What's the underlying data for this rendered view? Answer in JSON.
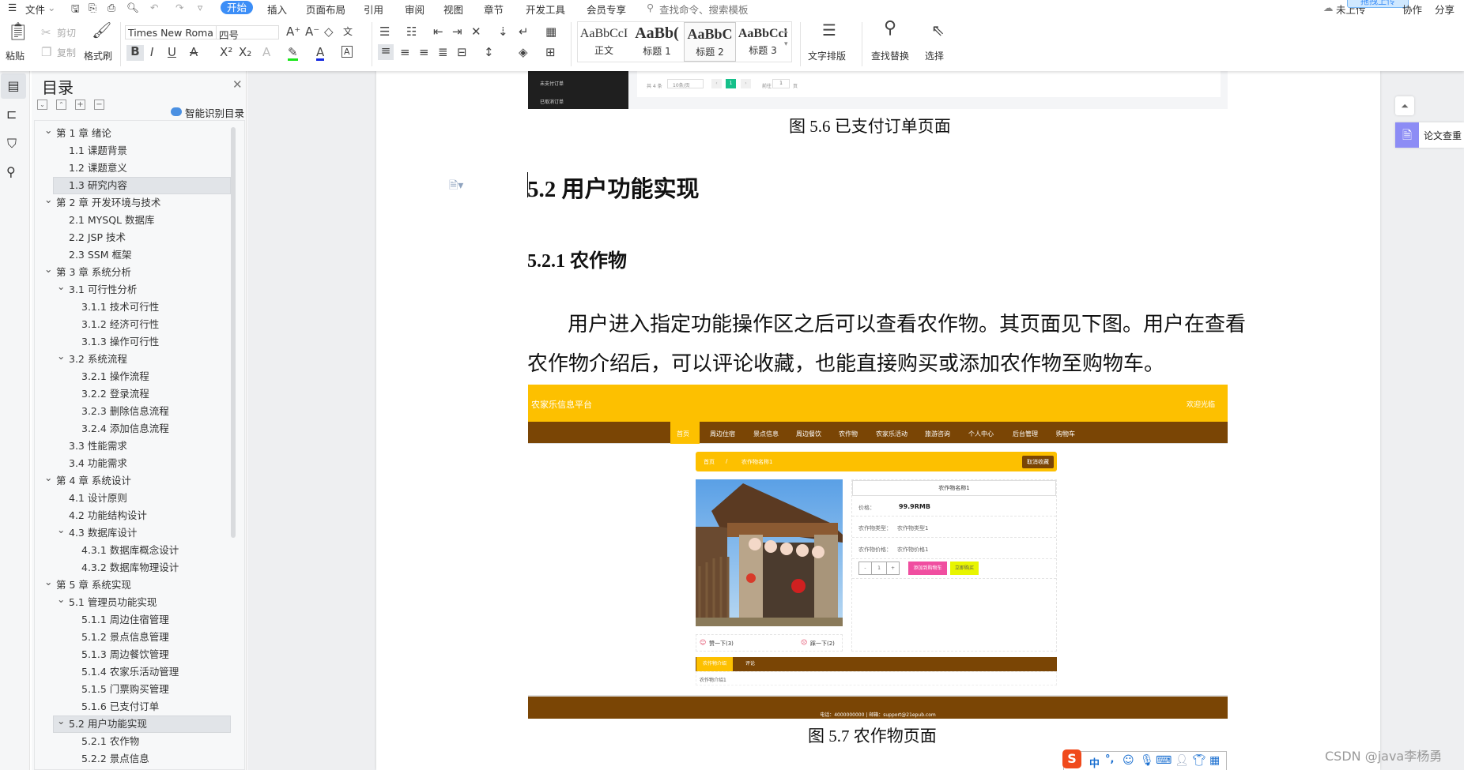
{
  "menu": {
    "file": "文件",
    "tabs": [
      "开始",
      "插入",
      "页面布局",
      "引用",
      "审阅",
      "视图",
      "章节",
      "开发工具",
      "会员专享"
    ],
    "search": "查找命令、搜索模板",
    "right": {
      "upload_status": "未上传",
      "drag_upload": "拖拽上传",
      "collab": "协作",
      "share": "分享"
    }
  },
  "ribbon": {
    "paste": "粘贴",
    "cut": "剪切",
    "copy": "复制",
    "format_painter": "格式刷",
    "font_name": "Times New Roma",
    "font_size": "四号",
    "styles": [
      {
        "sample": "AaBbCcI",
        "label": "正文"
      },
      {
        "sample": "AaBb(",
        "label": "标题 1"
      },
      {
        "sample": "AaBbC",
        "label": "标题 2"
      },
      {
        "sample": "AaBbCcl",
        "label": "标题 3"
      }
    ],
    "text_layout": "文字排版",
    "find_replace": "查找替换",
    "select": "选择"
  },
  "toc": {
    "title": "目录",
    "smart": "智能识别目录",
    "items": [
      {
        "t": "第 1 章  绪论",
        "l": 1,
        "a": true
      },
      {
        "t": "1.1  课题背景",
        "l": 2
      },
      {
        "t": "1.2  课题意义",
        "l": 2
      },
      {
        "t": "1.3  研究内容",
        "l": 2,
        "s": true
      },
      {
        "t": "第 2 章  开发环境与技术",
        "l": 1,
        "a": true
      },
      {
        "t": "2.1  MYSQL 数据库",
        "l": 2
      },
      {
        "t": "2.2  JSP 技术",
        "l": 2
      },
      {
        "t": "2.3  SSM 框架",
        "l": 2
      },
      {
        "t": "第 3 章  系统分析",
        "l": 1,
        "a": true
      },
      {
        "t": "3.1  可行性分析",
        "l": 2,
        "a": true
      },
      {
        "t": "3.1.1  技术可行性",
        "l": 3
      },
      {
        "t": "3.1.2  经济可行性",
        "l": 3
      },
      {
        "t": "3.1.3  操作可行性",
        "l": 3
      },
      {
        "t": "3.2  系统流程",
        "l": 2,
        "a": true
      },
      {
        "t": "3.2.1  操作流程",
        "l": 3
      },
      {
        "t": "3.2.2  登录流程",
        "l": 3
      },
      {
        "t": "3.2.3  删除信息流程",
        "l": 3
      },
      {
        "t": "3.2.4  添加信息流程",
        "l": 3
      },
      {
        "t": "3.3  性能需求",
        "l": 2
      },
      {
        "t": "3.4  功能需求",
        "l": 2
      },
      {
        "t": "第 4 章  系统设计",
        "l": 1,
        "a": true
      },
      {
        "t": "4.1  设计原则",
        "l": 2
      },
      {
        "t": "4.2  功能结构设计",
        "l": 2
      },
      {
        "t": "4.3  数据库设计",
        "l": 2,
        "a": true
      },
      {
        "t": "4.3.1  数据库概念设计",
        "l": 3
      },
      {
        "t": "4.3.2  数据库物理设计",
        "l": 3
      },
      {
        "t": "第 5 章  系统实现",
        "l": 1,
        "a": true
      },
      {
        "t": "5.1  管理员功能实现",
        "l": 2,
        "a": true
      },
      {
        "t": "5.1.1  周边住宿管理",
        "l": 3
      },
      {
        "t": "5.1.2  景点信息管理",
        "l": 3
      },
      {
        "t": "5.1.3  周边餐饮管理",
        "l": 3
      },
      {
        "t": "5.1.4  农家乐活动管理",
        "l": 3
      },
      {
        "t": "5.1.5  门票购买管理",
        "l": 3
      },
      {
        "t": "5.1.6  已支付订单",
        "l": 3
      },
      {
        "t": "5.2  用户功能实现",
        "l": 2,
        "a": true,
        "s": true
      },
      {
        "t": "5.2.1  农作物",
        "l": 3
      },
      {
        "t": "5.2.2  景点信息",
        "l": 3
      }
    ]
  },
  "prev_figure": {
    "menu": [
      "未支付订单",
      "已取消订单"
    ],
    "total": "共 4 条",
    "per_page": "10条/页",
    "page": "1",
    "goto": "前往",
    "goto_value": "1",
    "page_unit": "页"
  },
  "doc": {
    "caption_56": "图 5.6  已支付订单页面",
    "h2": "5.2  用户功能实现",
    "h3": "5.2.1  农作物",
    "para1": "用户进入指定功能操作区之后可以查看农作物。其页面见下图。用户在查看",
    "para2": "农作物介绍后，可以评论收藏，也能直接购买或添加农作物至购物车。",
    "caption_57": "图 5.7  农作物页面"
  },
  "site": {
    "title": "农家乐信息平台",
    "welcome": "欢迎光临",
    "nav": [
      "首页",
      "周边住宿",
      "景点信息",
      "周边餐饮",
      "农作物",
      "农家乐活动",
      "旅游咨询",
      "个人中心",
      "后台管理",
      "购物车"
    ],
    "crumb_home": "首页",
    "crumb_sep": "/",
    "crumb_item": "农作物名称1",
    "unfav": "取消收藏",
    "name": "农作物名称1",
    "price_label": "价格：",
    "price": "99.9RMB",
    "type_label": "农作物类型：",
    "type": "农作物类型1",
    "intro_label": "农作物价格：",
    "intro": "农作物价格1",
    "qty": "1",
    "minus": "-",
    "plus": "+",
    "add_cart": "添加到购物车",
    "buy": "立即购买",
    "like": "赞一下(3)",
    "dislike": "踩一下(2)",
    "tabs": [
      "农作物介绍",
      "评论"
    ],
    "intro_text": "农作物介绍1",
    "footer": "电话：4000000000 | 邮箱：support@21epub.com",
    "colors": {
      "yellow": "#fdc000",
      "brown": "#7a4505",
      "pink": "#f04ea0",
      "lime": "#e8f500"
    }
  },
  "side": {
    "paper_check": "论文查重"
  },
  "watermark": "CSDN @java李杨勇",
  "ime": {
    "lang": "中",
    "punct": "°,"
  }
}
